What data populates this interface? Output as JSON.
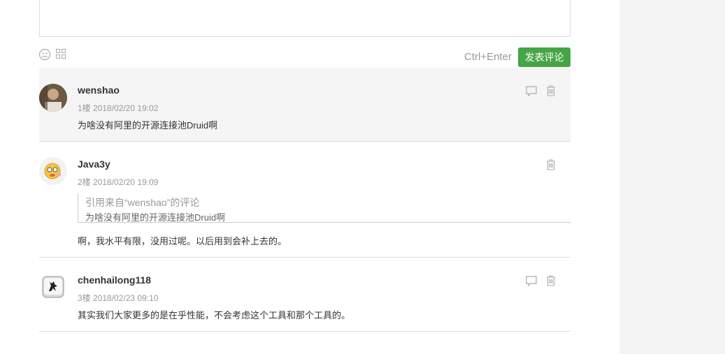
{
  "editor": {
    "hint": "Ctrl+Enter",
    "submit_label": "发表评论",
    "accent": "#46a546"
  },
  "comments": [
    {
      "author": "wenshao",
      "meta": "1楼 2018/02/20 19:02",
      "content": "为啥没有阿里的开源连接池Druid啊"
    },
    {
      "author": "Java3y",
      "meta": "2楼 2018/02/20 19:09",
      "quote_title": "引用来自“wenshao”的评论",
      "quote_text": "为啥没有阿里的开源连接池Druid啊",
      "content": "啊，我水平有限，没用过呢。以后用到会补上去的。"
    },
    {
      "author": "chenhailong118",
      "meta": "3楼 2018/02/23 09:10",
      "content": "其实我们大家更多的是在乎性能，不会考虑这个工具和那个工具的。"
    }
  ]
}
